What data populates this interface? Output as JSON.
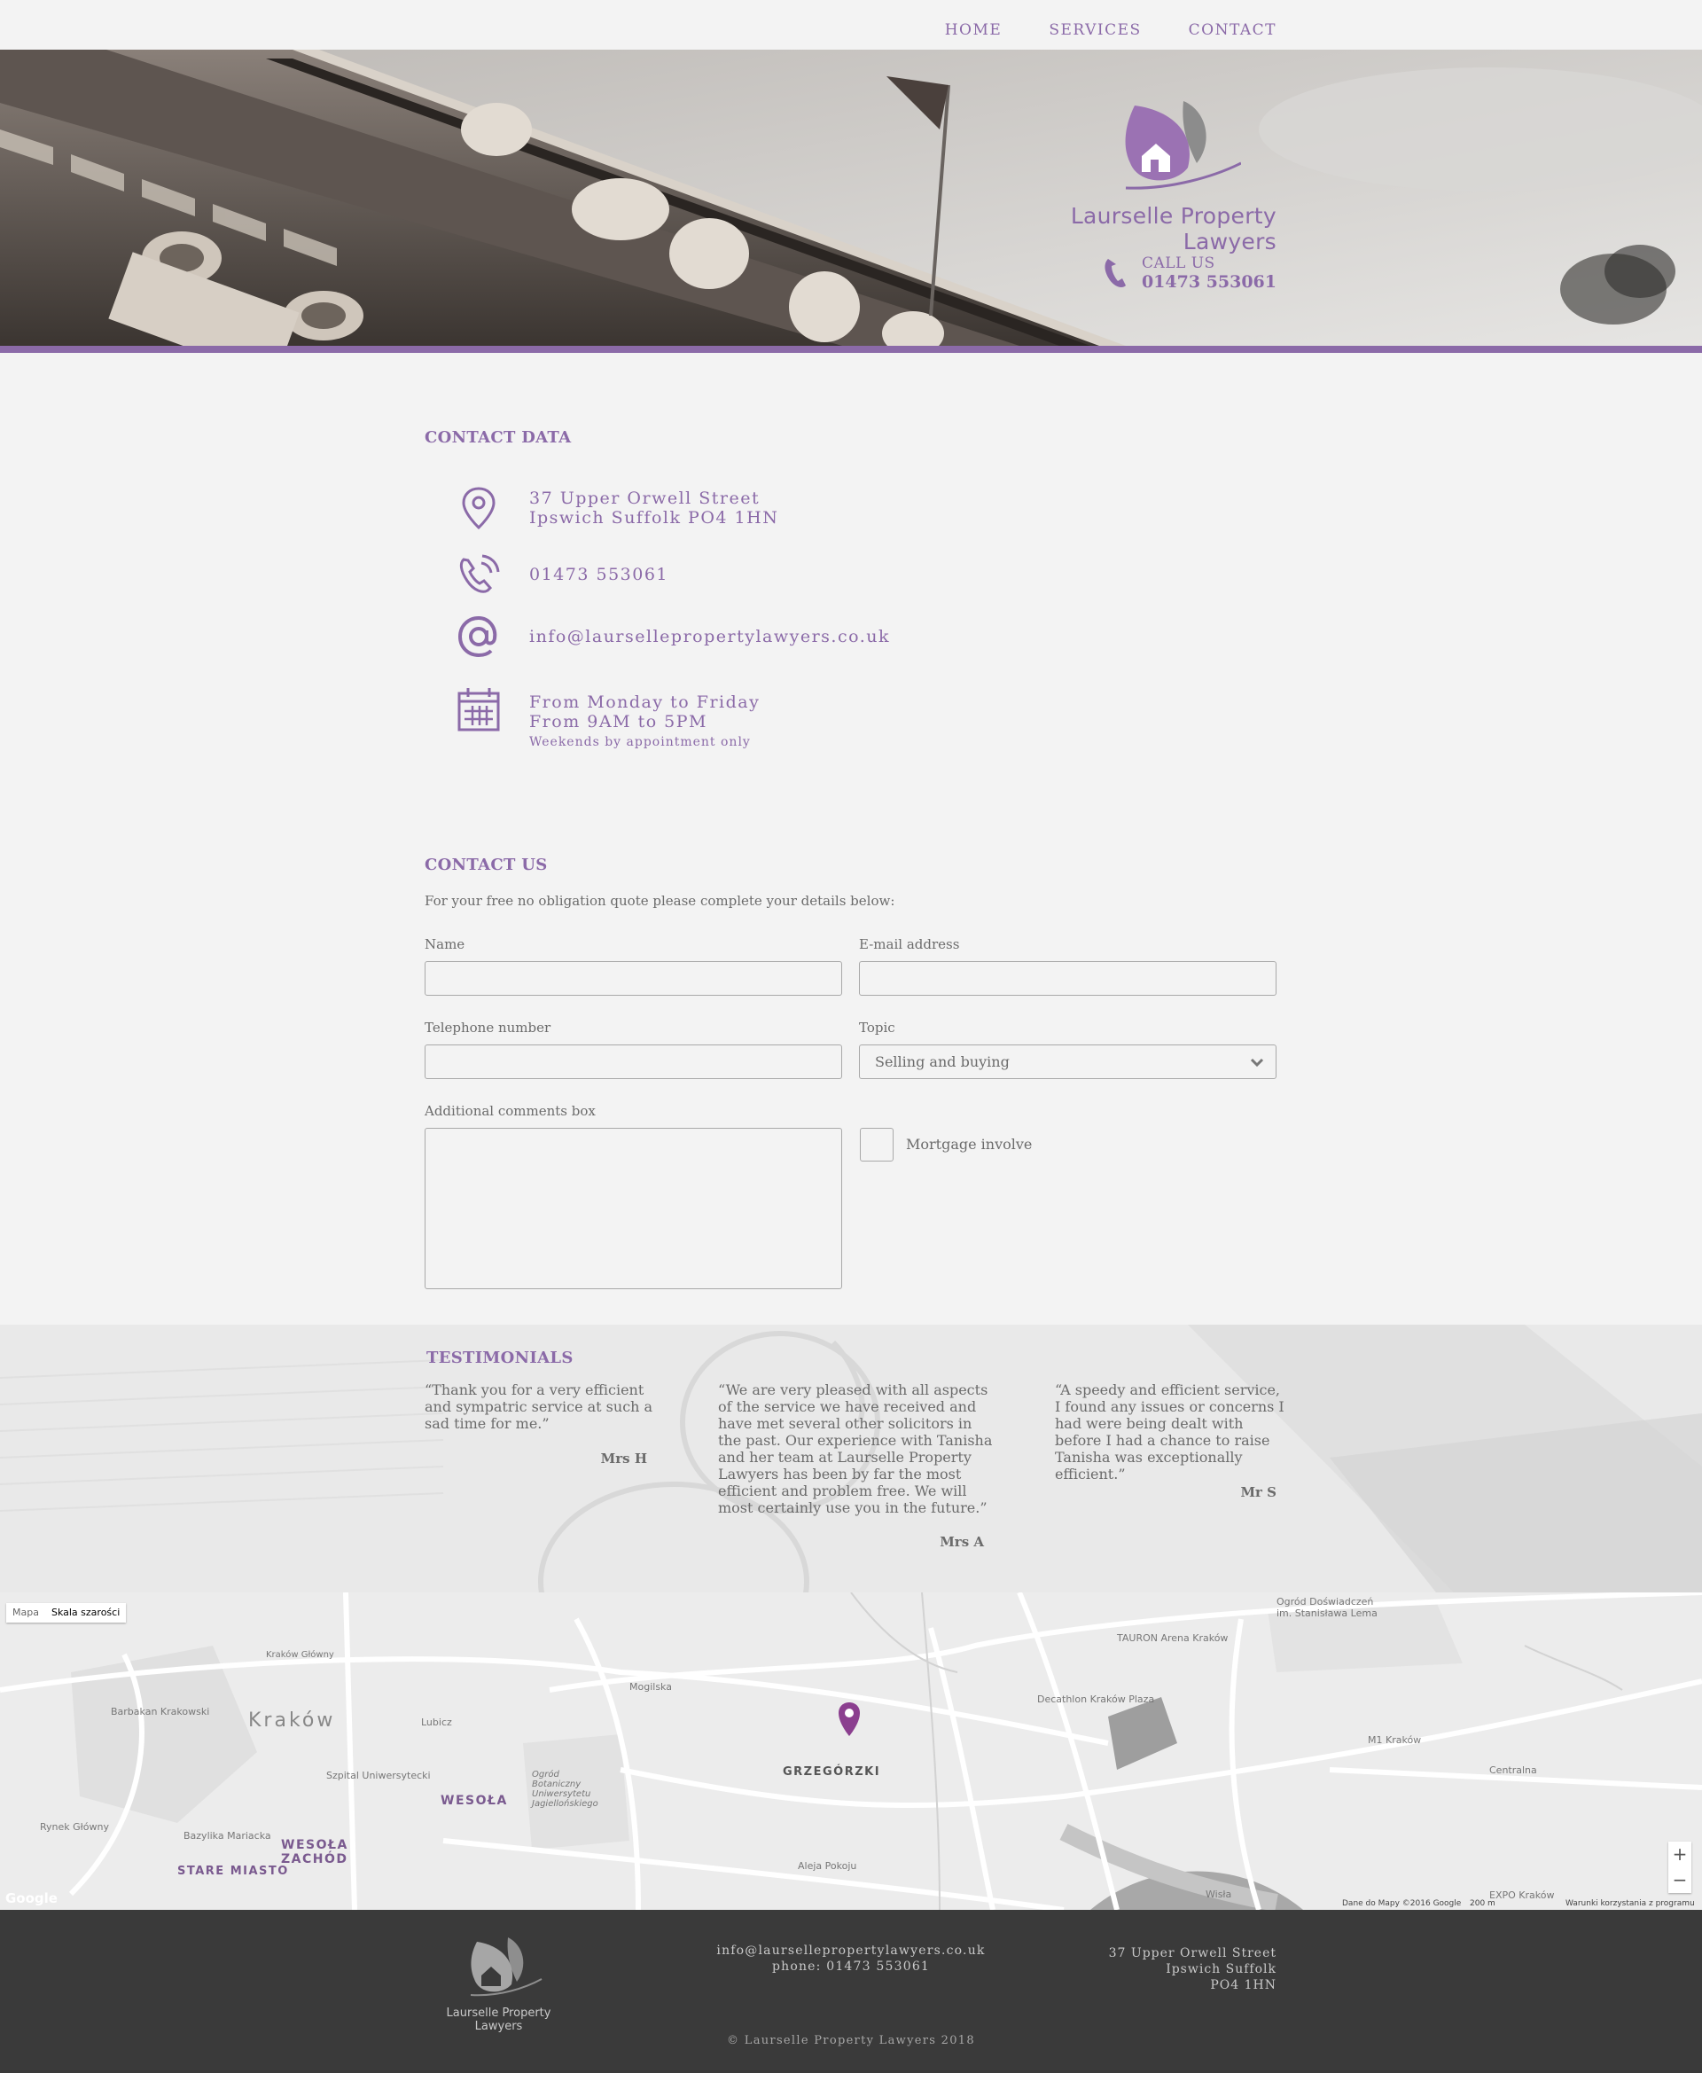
{
  "nav": {
    "items": [
      "HOME",
      "SERVICES",
      "CONTACT"
    ]
  },
  "hero": {
    "brand_name": "Laurselle Property Lawyers",
    "call_label": "CALL US",
    "call_number": "01473 553061",
    "accent_color": "#8b6aa8"
  },
  "contact_data": {
    "heading": "CONTACT DATA",
    "address_line1": "37 Upper Orwell Street",
    "address_line2": "Ipswich Suffolk PO4 1HN",
    "phone": "01473 553061",
    "email": "info@laursellepropertylawyers.co.uk",
    "hours_line1": "From Monday to Friday",
    "hours_line2": "From 9AM to 5PM",
    "hours_note": "Weekends by appointment only"
  },
  "contact_us": {
    "heading": "CONTACT US",
    "intro": "For your free no obligation quote please complete your details below:",
    "name_label": "Name",
    "name_value": "",
    "email_label": "E-mail address",
    "email_value": "",
    "phone_label": "Telephone number",
    "phone_value": "",
    "topic_label": "Topic",
    "topic_selected": "Selling and buying",
    "comments_label": "Additional comments box",
    "comments_value": "",
    "mortgage_label": "Mortgage involve"
  },
  "testimonials": {
    "heading": "TESTIMONIALS",
    "items": [
      {
        "quote": "“Thank you for a very efficient and sympatric service at such a sad time for me.”",
        "author": "Mrs H"
      },
      {
        "quote": "“We are very pleased with all aspects of the service we have received and have met several other solicitors in the past. Our experience with Tanisha and her team at Laurselle Property Lawyers has been by far the most efficient and problem free. We will most certainly use you in the future.”",
        "author": "Mrs A"
      },
      {
        "quote": "“A speedy and efficient service, I found any issues or concerns I had were being dealt with before I had a chance to raise Tanisha was exceptionally efficient.”",
        "author": "Mr S"
      }
    ]
  },
  "map": {
    "toggle_map": "Mapa",
    "toggle_gray": "Skala szarości",
    "city": "Kraków",
    "district_marker": "GRZEGÓRZKI",
    "district_wesola": "WESOŁA",
    "district_wesola_zachod_1": "WESOŁA",
    "district_wesola_zachod_2": "ZACHÓD",
    "district_stare_miasto": "STARE MIASTO",
    "labels": {
      "tauron": "TAURON Arena Kraków",
      "decathlon": "Decathlon Kraków Plaza",
      "m1": "M1 Kraków",
      "ogrod1": "Ogród Doświadczeń",
      "ogrod2": "im. Stanisława Lema",
      "botaniczny": "Ogród Botaniczny Uniwersytetu Jagiellońskiego",
      "glowny": "Kraków Główny",
      "barbakan": "Barbakan Krakowski",
      "rynek": "Rynek Główny",
      "bazylika": "Bazylika Mariacka",
      "szpital": "Szpital Uniwersytecki",
      "mogilska": "Mogilska",
      "lubicz": "Lubicz",
      "aleja_pokoju": "Aleja Pokoju",
      "centralna": "Centralna",
      "wisla": "Wisła",
      "expo": "EXPO Kraków",
      "attribution": "Dane do Mapy ©2016 Google",
      "scale": "200 m",
      "terms": "Warunki korzystania z programu",
      "google": "Google"
    },
    "zoom_in": "+",
    "zoom_out": "−"
  },
  "footer": {
    "brand_name": "Laurselle Property Lawyers",
    "email": "info@laursellepropertylawyers.co.uk",
    "phone": "phone: 01473 553061",
    "address_line1": "37 Upper Orwell Street",
    "address_line2": "Ipswich Suffolk",
    "address_line3": "PO4 1HN",
    "copyright": "© Laurselle Property Lawyers 2018"
  }
}
